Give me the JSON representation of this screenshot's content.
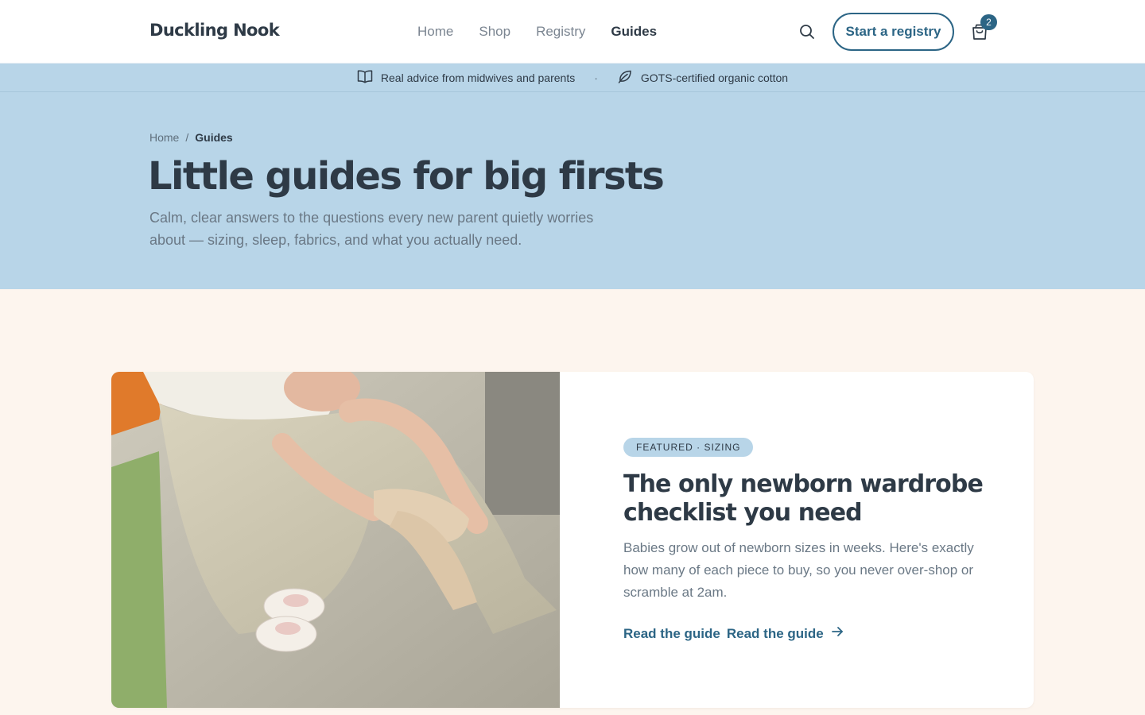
{
  "brand": {
    "name": "Duckling Nook"
  },
  "nav": {
    "items": [
      {
        "label": "Home"
      },
      {
        "label": "Shop"
      },
      {
        "label": "Registry"
      },
      {
        "label": "Guides"
      }
    ],
    "active": "Guides"
  },
  "header": {
    "registry_button": "Start a registry",
    "cart_count": "2",
    "search_icon": "search-icon",
    "cart_icon": "shopping-bag-icon"
  },
  "announcement": {
    "items": [
      {
        "icon": "open-book-icon",
        "text": "Real advice from midwives and parents"
      },
      {
        "icon": "leaf-icon",
        "text": "GOTS-certified organic cotton"
      }
    ],
    "separator": "·"
  },
  "breadcrumb": {
    "home": "Home",
    "separator": "/",
    "current": "Guides"
  },
  "hero": {
    "title": "Little guides for big firsts",
    "subtitle": "Calm, clear answers to the questions every new parent quietly worries about — sizing, sleep, fabrics, and what you actually need."
  },
  "featured": {
    "tag": "FEATURED · SIZING",
    "title": "The only newborn wardrobe checklist you need",
    "description": "Babies grow out of newborn sizes in weeks. Here's exactly how many of each piece to buy, so you never over-shop or scramble at 2am.",
    "link_label": "Read the guide",
    "link_label_repeat": "Read the guide",
    "link_icon": "arrow-right-icon"
  },
  "colors": {
    "brand": "#2c6585",
    "hero_bg": "#b8d5e8",
    "page_bg": "#fdf5ee",
    "text": "#2e3a46",
    "muted": "#6a7885"
  }
}
